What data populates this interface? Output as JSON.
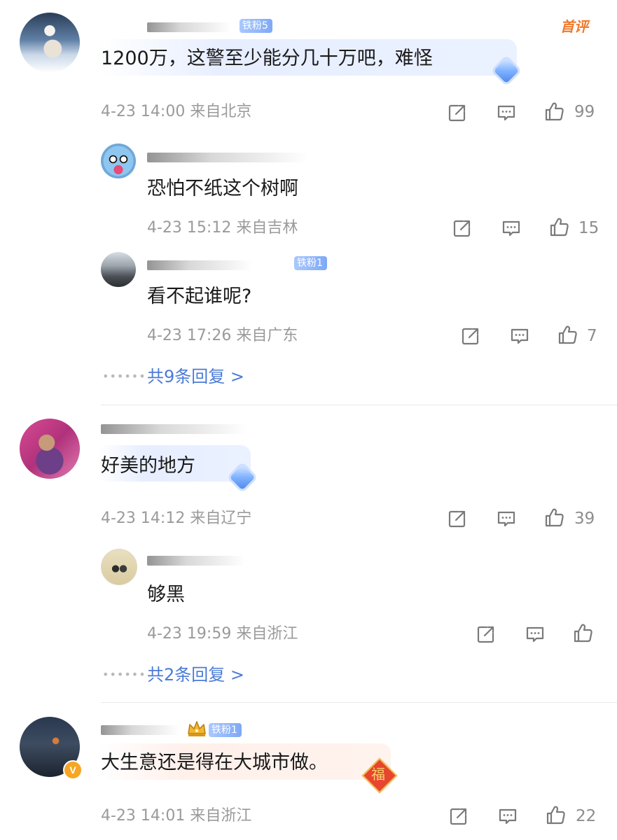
{
  "comments": [
    {
      "text": "1200万，这警至少能分几十万吧，难怪",
      "fan_badge": "铁粉5",
      "tag": "首评",
      "time": "4-23 14:00",
      "location": "来自北京",
      "likes": "99",
      "replies": [
        {
          "text": "恐怕不纸这个树啊",
          "time": "4-23 15:12",
          "location": "来自吉林",
          "likes": "15"
        },
        {
          "text": "看不起谁呢?",
          "fan_badge": "铁粉1",
          "time": "4-23 17:26",
          "location": "来自广东",
          "likes": "7"
        }
      ],
      "more_replies": "共9条回复 >"
    },
    {
      "text": "好美的地方",
      "time": "4-23 14:12",
      "location": "来自辽宁",
      "likes": "39",
      "replies": [
        {
          "text": "够黑",
          "time": "4-23 19:59",
          "location": "来自浙江",
          "likes": ""
        }
      ],
      "more_replies": "共2条回复 >"
    },
    {
      "text": "大生意还是得在大城市做。",
      "fan_badge": "铁粉1",
      "verified_mark": "V",
      "fu_badge": "福",
      "time": "4-23 14:01",
      "location": "来自浙江",
      "likes": "22"
    }
  ],
  "icons": {
    "share": "share-icon",
    "comment": "comment-icon",
    "like": "like-icon"
  },
  "colors": {
    "link": "#4a7bd6",
    "meta": "#9a9a9a",
    "fan_badge": "#7fa9f6",
    "top_tag": "#f07a2d"
  }
}
